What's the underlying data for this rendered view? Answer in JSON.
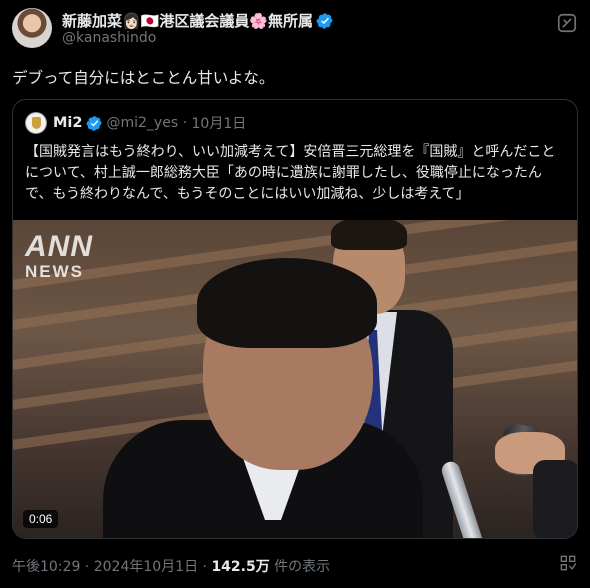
{
  "author": {
    "display_name": "新藤加菜👩🏻🇯🇵港区議会議員🌸無所属",
    "handle": "@kanashindo"
  },
  "tweet": {
    "text": "デブって自分にはとことん甘いよな。"
  },
  "quote": {
    "display_name": "Mi2",
    "handle": "@mi2_yes",
    "separator": "·",
    "date": "10月1日",
    "text": "【国賊発言はもう終わり、いい加減考えて】安倍晋三元総理を『国賊』と呼んだことについて、村上誠一郎総務大臣「あの時に遺族に謝罪したし、役職停止になったんで、もう終わりなんで、もうそのことにはいい加減ね、少しは考えて」",
    "media": {
      "watermark_top": "ANN",
      "watermark_bottom": "NEWS",
      "duration": "0:06"
    }
  },
  "footer": {
    "time": "午後10:29",
    "sep1": " · ",
    "date": "2024年10月1日",
    "sep2": " · ",
    "views": "142.5万",
    "views_suffix": " 件の表示"
  },
  "colors": {
    "background": "#000000",
    "text_primary": "#e7e9ea",
    "text_secondary": "#71767b",
    "verified": "#1d9bf0",
    "border": "#2f3336"
  },
  "icons": {
    "verified": "verified-badge-icon",
    "grok": "grok-icon",
    "stats": "view-stats-icon"
  }
}
